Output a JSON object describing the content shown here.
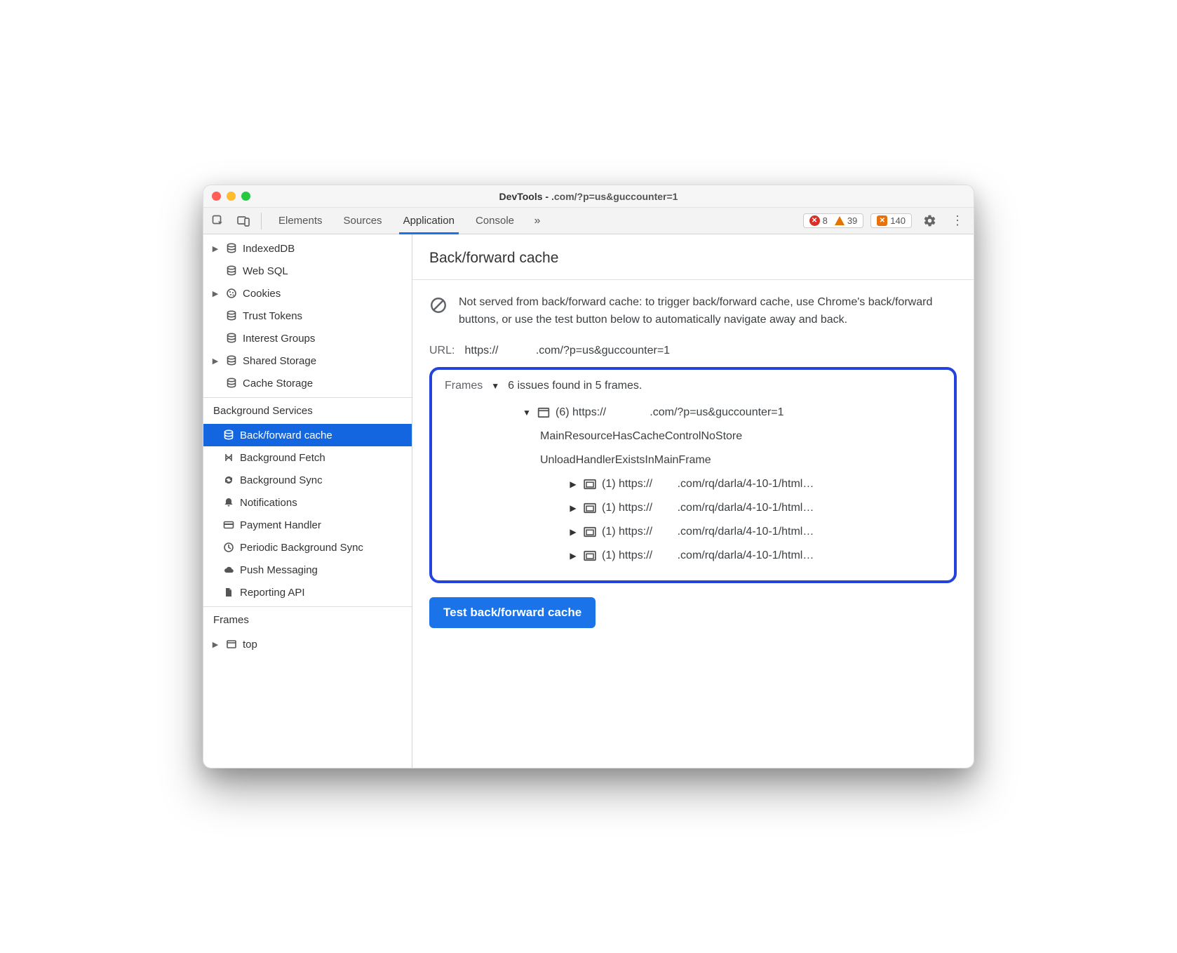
{
  "window": {
    "title_prefix": "DevTools - ",
    "title_url": ".com/?p=us&guccounter=1"
  },
  "toolbar": {
    "tabs": [
      "Elements",
      "Sources",
      "Application",
      "Console"
    ],
    "active_tab_index": 2,
    "more_glyph": "»",
    "errors_count": "8",
    "warnings_count": "39",
    "issues_count": "140"
  },
  "sidebar": {
    "storage": [
      {
        "label": "IndexedDB",
        "icon": "db",
        "arrow": true
      },
      {
        "label": "Web SQL",
        "icon": "db"
      },
      {
        "label": "Cookies",
        "icon": "cookie",
        "arrow": true
      },
      {
        "label": "Trust Tokens",
        "icon": "db"
      },
      {
        "label": "Interest Groups",
        "icon": "db"
      },
      {
        "label": "Shared Storage",
        "icon": "db",
        "arrow": true
      },
      {
        "label": "Cache Storage",
        "icon": "db"
      }
    ],
    "bg_section_label": "Background Services",
    "background_services": [
      {
        "label": "Back/forward cache",
        "icon": "db",
        "selected": true
      },
      {
        "label": "Background Fetch",
        "icon": "fetch"
      },
      {
        "label": "Background Sync",
        "icon": "sync"
      },
      {
        "label": "Notifications",
        "icon": "bell"
      },
      {
        "label": "Payment Handler",
        "icon": "card"
      },
      {
        "label": "Periodic Background Sync",
        "icon": "clock",
        "truncate": true
      },
      {
        "label": "Push Messaging",
        "icon": "cloud"
      },
      {
        "label": "Reporting API",
        "icon": "doc"
      }
    ],
    "frames_section_label": "Frames",
    "frames": [
      {
        "label": "top",
        "icon": "window",
        "arrow": true
      }
    ]
  },
  "main": {
    "heading": "Back/forward cache",
    "notice": "Not served from back/forward cache: to trigger back/forward cache, use Chrome's back/forward buttons, or use the test button below to automatically navigate away and back.",
    "url_label": "URL:",
    "url_value": "https://            .com/?p=us&guccounter=1",
    "frames_label": "Frames",
    "frames_summary": "6 issues found in 5 frames.",
    "top_frame": {
      "count": "(6)",
      "url": "https://              .com/?p=us&guccounter=1",
      "reasons": [
        "MainResourceHasCacheControlNoStore",
        "UnloadHandlerExistsInMainFrame"
      ],
      "subframes": [
        {
          "count": "(1)",
          "url": "https://        .com/rq/darla/4-10-1/html…"
        },
        {
          "count": "(1)",
          "url": "https://        .com/rq/darla/4-10-1/html…"
        },
        {
          "count": "(1)",
          "url": "https://        .com/rq/darla/4-10-1/html…"
        },
        {
          "count": "(1)",
          "url": "https://        .com/rq/darla/4-10-1/html…"
        }
      ]
    },
    "test_button": "Test back/forward cache"
  }
}
